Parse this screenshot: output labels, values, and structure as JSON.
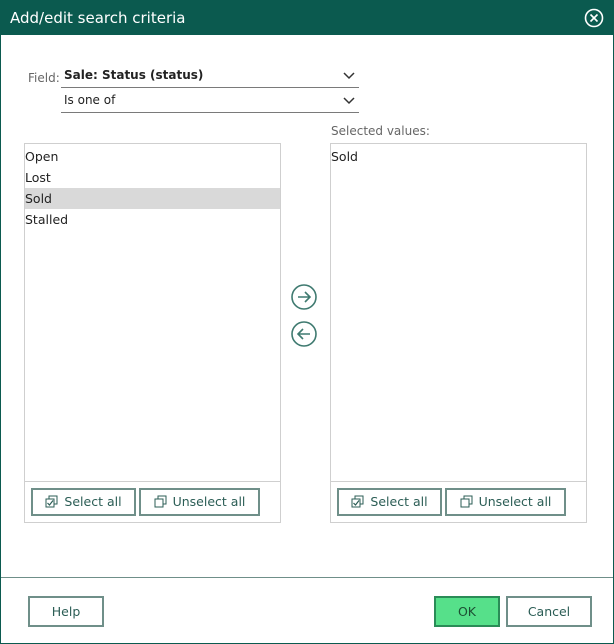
{
  "dialog": {
    "title": "Add/edit search criteria"
  },
  "criteria": {
    "field_label": "Field:",
    "field_value": "Sale: Status (status)",
    "operator_value": "Is one of"
  },
  "available": {
    "items": [
      {
        "label": "Open",
        "selected": false
      },
      {
        "label": "Lost",
        "selected": false
      },
      {
        "label": "Sold",
        "selected": true
      },
      {
        "label": "Stalled",
        "selected": false
      }
    ],
    "select_all_label": "Select all",
    "unselect_all_label": "Unselect all"
  },
  "selected_values": {
    "caption": "Selected values:",
    "items": [
      {
        "label": "Sold"
      }
    ],
    "select_all_label": "Select all",
    "unselect_all_label": "Unselect all"
  },
  "footer": {
    "help_label": "Help",
    "ok_label": "OK",
    "cancel_label": "Cancel"
  },
  "colors": {
    "accent": "#0b5a4f",
    "ok_button": "#56e08a",
    "selected_row": "#d9d9d9"
  },
  "icons": {
    "close": "close-circle-icon",
    "move_right": "arrow-right-circle-icon",
    "move_left": "arrow-left-circle-icon",
    "dropdown": "chevron-down-icon",
    "select_all": "checked-boxes-icon",
    "unselect_all": "unchecked-boxes-icon"
  }
}
